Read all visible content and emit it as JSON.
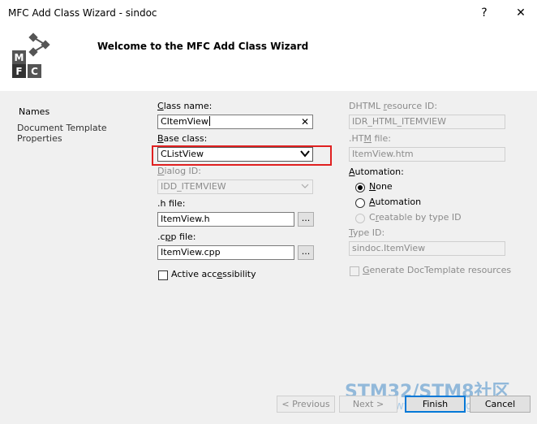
{
  "window": {
    "title": "MFC Add Class Wizard - sindoc",
    "help_label": "?",
    "close_label": "✕"
  },
  "header": {
    "title": "Welcome to the MFC Add Class Wizard",
    "logo_letters": [
      "M",
      "F",
      "C"
    ]
  },
  "nav": {
    "items": [
      {
        "label": "Names"
      },
      {
        "label": "Document Template Properties"
      }
    ]
  },
  "form": {
    "class_name": {
      "label_pre": "",
      "label_u": "C",
      "label_post": "lass name:",
      "value": "CItemView",
      "clear_label": "✕"
    },
    "base_class": {
      "label_u": "B",
      "label_post": "ase class:",
      "value": "CListView"
    },
    "dialog_id": {
      "label_u": "D",
      "label_post": "ialog ID:",
      "value": "IDD_ITEMVIEW"
    },
    "h_file": {
      "label_pre": ".h f",
      "label_u": "i",
      "label_post": "le:",
      "value": "ItemView.h",
      "browse_label": "..."
    },
    "cpp_file": {
      "label_pre": ".c",
      "label_u": "p",
      "label_post": "p file:",
      "value": "ItemView.cpp",
      "browse_label": "..."
    },
    "active_accessibility": {
      "label_pre": "Active acc",
      "label_u": "e",
      "label_post": "ssibility"
    }
  },
  "right": {
    "dhtml_id": {
      "label_pre": "DHTML ",
      "label_u": "r",
      "label_post": "esource ID:",
      "value": "IDR_HTML_ITEMVIEW"
    },
    "htm_file": {
      "label_pre": ".HT",
      "label_u": "M",
      "label_post": " file:",
      "value": "ItemView.htm"
    },
    "automation": {
      "label_pre": "",
      "label_u": "A",
      "label_post": "utomation:",
      "options": [
        {
          "label_u": "N",
          "label_post": "one",
          "selected": true,
          "enabled": true
        },
        {
          "label_u": "A",
          "label_post": "utomation",
          "selected": false,
          "enabled": true
        },
        {
          "label_pre": "C",
          "label_u": "r",
          "label_post": "eatable by type ID",
          "selected": false,
          "enabled": false
        }
      ]
    },
    "type_id": {
      "label_pre": "",
      "label_u": "T",
      "label_post": "ype ID:",
      "value": "sindoc.ItemView"
    },
    "generate_doc": {
      "label_pre": "",
      "label_u": "G",
      "label_post": "enerate DocTemplate resources"
    }
  },
  "buttons": {
    "previous": "< Previous",
    "next": "Next >",
    "finish": "Finish",
    "cancel": "Cancel"
  },
  "watermark": {
    "text": "STM32/STM8社区",
    "url": "www.stmcu.org"
  },
  "colors": {
    "highlight": "#e02020",
    "default_button": "#0078d7",
    "watermark": "#468cc8"
  }
}
